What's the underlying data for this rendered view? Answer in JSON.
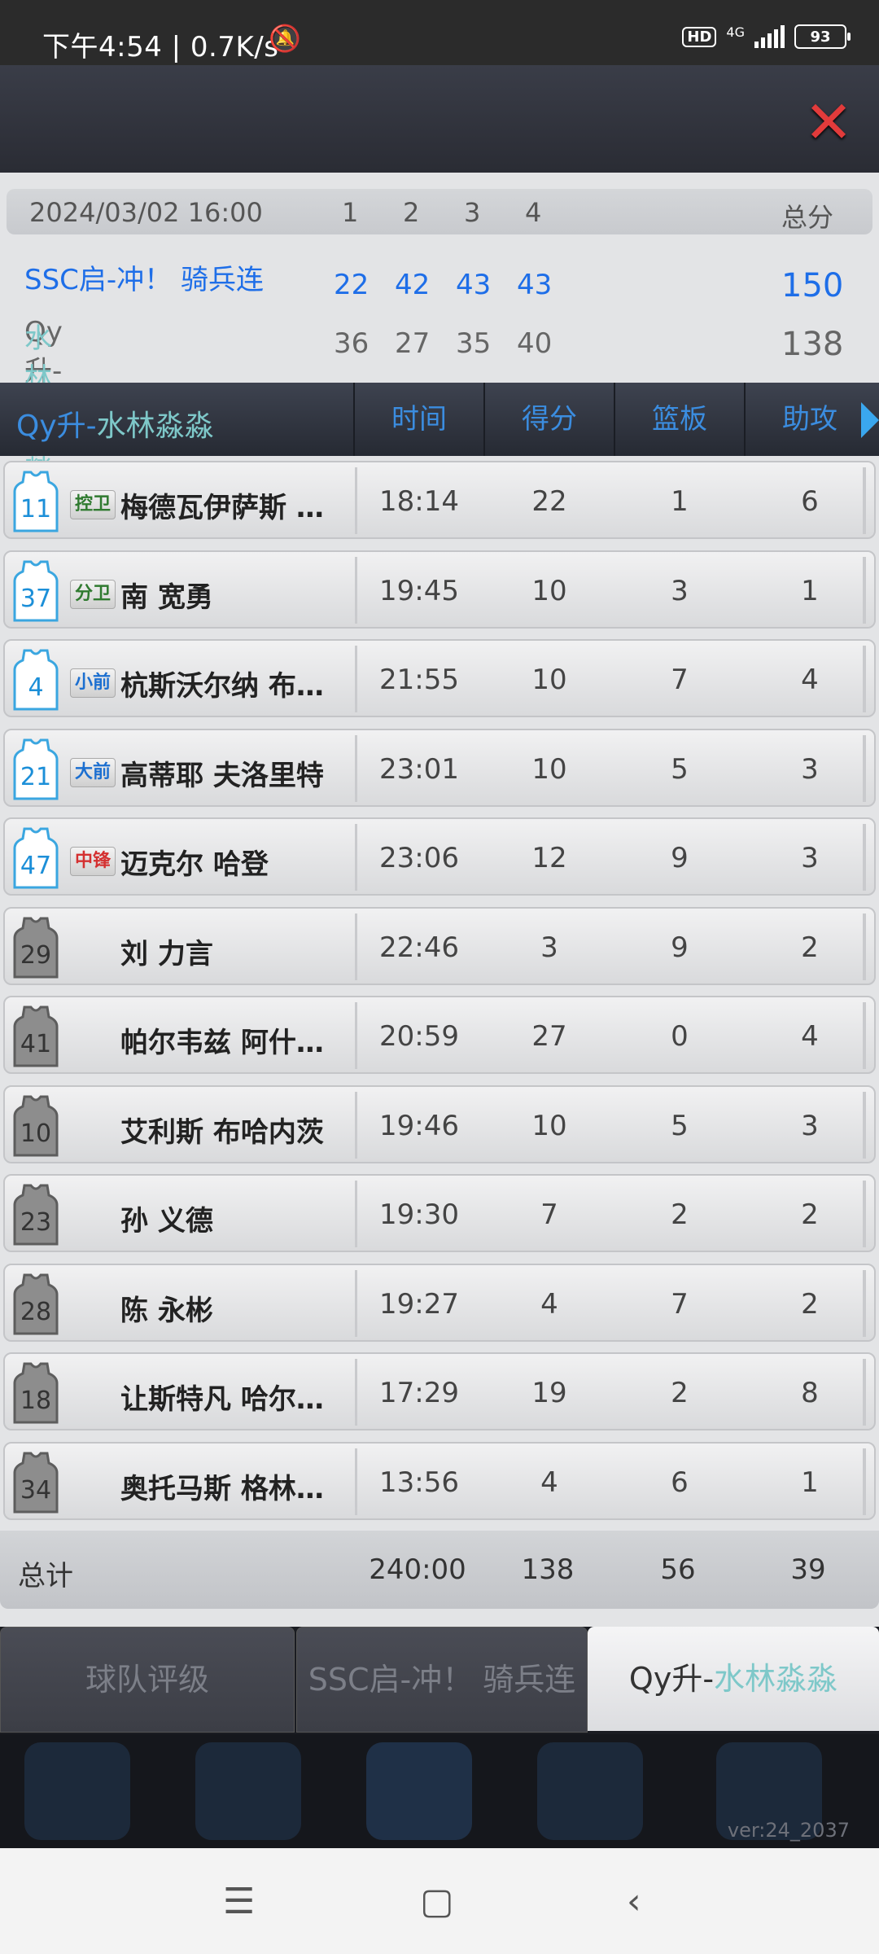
{
  "status_bar": {
    "time": "下午4:54 | 0.7K/s",
    "hd": "HD",
    "network": "4G",
    "battery": "93"
  },
  "scoreboard": {
    "datetime": "2024/03/02 16:00",
    "quarters": [
      "1",
      "2",
      "3",
      "4"
    ],
    "total_label": "总分",
    "home": {
      "name_a": "SSC启-冲！ 骑兵连",
      "scores": [
        "22",
        "42",
        "43",
        "43"
      ],
      "total": "150"
    },
    "away": {
      "name_prefix": "Qy升-",
      "name_suffix": "水林淼淼",
      "scores": [
        "36",
        "27",
        "35",
        "40"
      ],
      "total": "138"
    }
  },
  "table": {
    "team_prefix": "Qy升-",
    "team_suffix": "水林淼淼",
    "columns": [
      "时间",
      "得分",
      "篮板",
      "助攻"
    ],
    "rows": [
      {
        "number": "11",
        "position": "控卫",
        "name": "梅德瓦伊萨斯 莱...",
        "time": "18:14",
        "pts": "22",
        "reb": "1",
        "ast": "6"
      },
      {
        "number": "37",
        "position": "分卫",
        "name": "南 宽勇",
        "time": "19:45",
        "pts": "10",
        "reb": "3",
        "ast": "1"
      },
      {
        "number": "4",
        "position": "小前",
        "name": "杭斯沃尔纳 布伦...",
        "time": "21:55",
        "pts": "10",
        "reb": "7",
        "ast": "4"
      },
      {
        "number": "21",
        "position": "大前",
        "name": "高蒂耶 夫洛里特",
        "time": "23:01",
        "pts": "10",
        "reb": "5",
        "ast": "3"
      },
      {
        "number": "47",
        "position": "中锋",
        "name": "迈克尔 哈登",
        "time": "23:06",
        "pts": "12",
        "reb": "9",
        "ast": "3"
      },
      {
        "number": "29",
        "position": "",
        "name": "刘 力言",
        "time": "22:46",
        "pts": "3",
        "reb": "9",
        "ast": "2"
      },
      {
        "number": "41",
        "position": "",
        "name": "帕尔韦兹 阿什拉夫",
        "time": "20:59",
        "pts": "27",
        "reb": "0",
        "ast": "4"
      },
      {
        "number": "10",
        "position": "",
        "name": "艾利斯 布哈内茨",
        "time": "19:46",
        "pts": "10",
        "reb": "5",
        "ast": "3"
      },
      {
        "number": "23",
        "position": "",
        "name": "孙 义德",
        "time": "19:30",
        "pts": "7",
        "reb": "2",
        "ast": "2"
      },
      {
        "number": "28",
        "position": "",
        "name": "陈 永彬",
        "time": "19:27",
        "pts": "4",
        "reb": "7",
        "ast": "2"
      },
      {
        "number": "18",
        "position": "",
        "name": "让斯特凡 哈尔恩瓦",
        "time": "17:29",
        "pts": "19",
        "reb": "2",
        "ast": "8"
      },
      {
        "number": "34",
        "position": "",
        "name": "奥托马斯 格林瓦...",
        "time": "13:56",
        "pts": "4",
        "reb": "6",
        "ast": "1"
      }
    ],
    "total": {
      "label": "总计",
      "time": "240:00",
      "pts": "138",
      "reb": "56",
      "ast": "39"
    }
  },
  "tabs": {
    "team_rating": "球队评级",
    "home_team": "SSC启-冲！ 骑兵连",
    "away_prefix": "Qy升-",
    "away_suffix": "水林淼淼"
  },
  "version": "ver:24_2037",
  "colors": {
    "accent_blue": "#1e6ee8",
    "teal": "#7ec8c9",
    "close_red": "#e23b3b"
  }
}
